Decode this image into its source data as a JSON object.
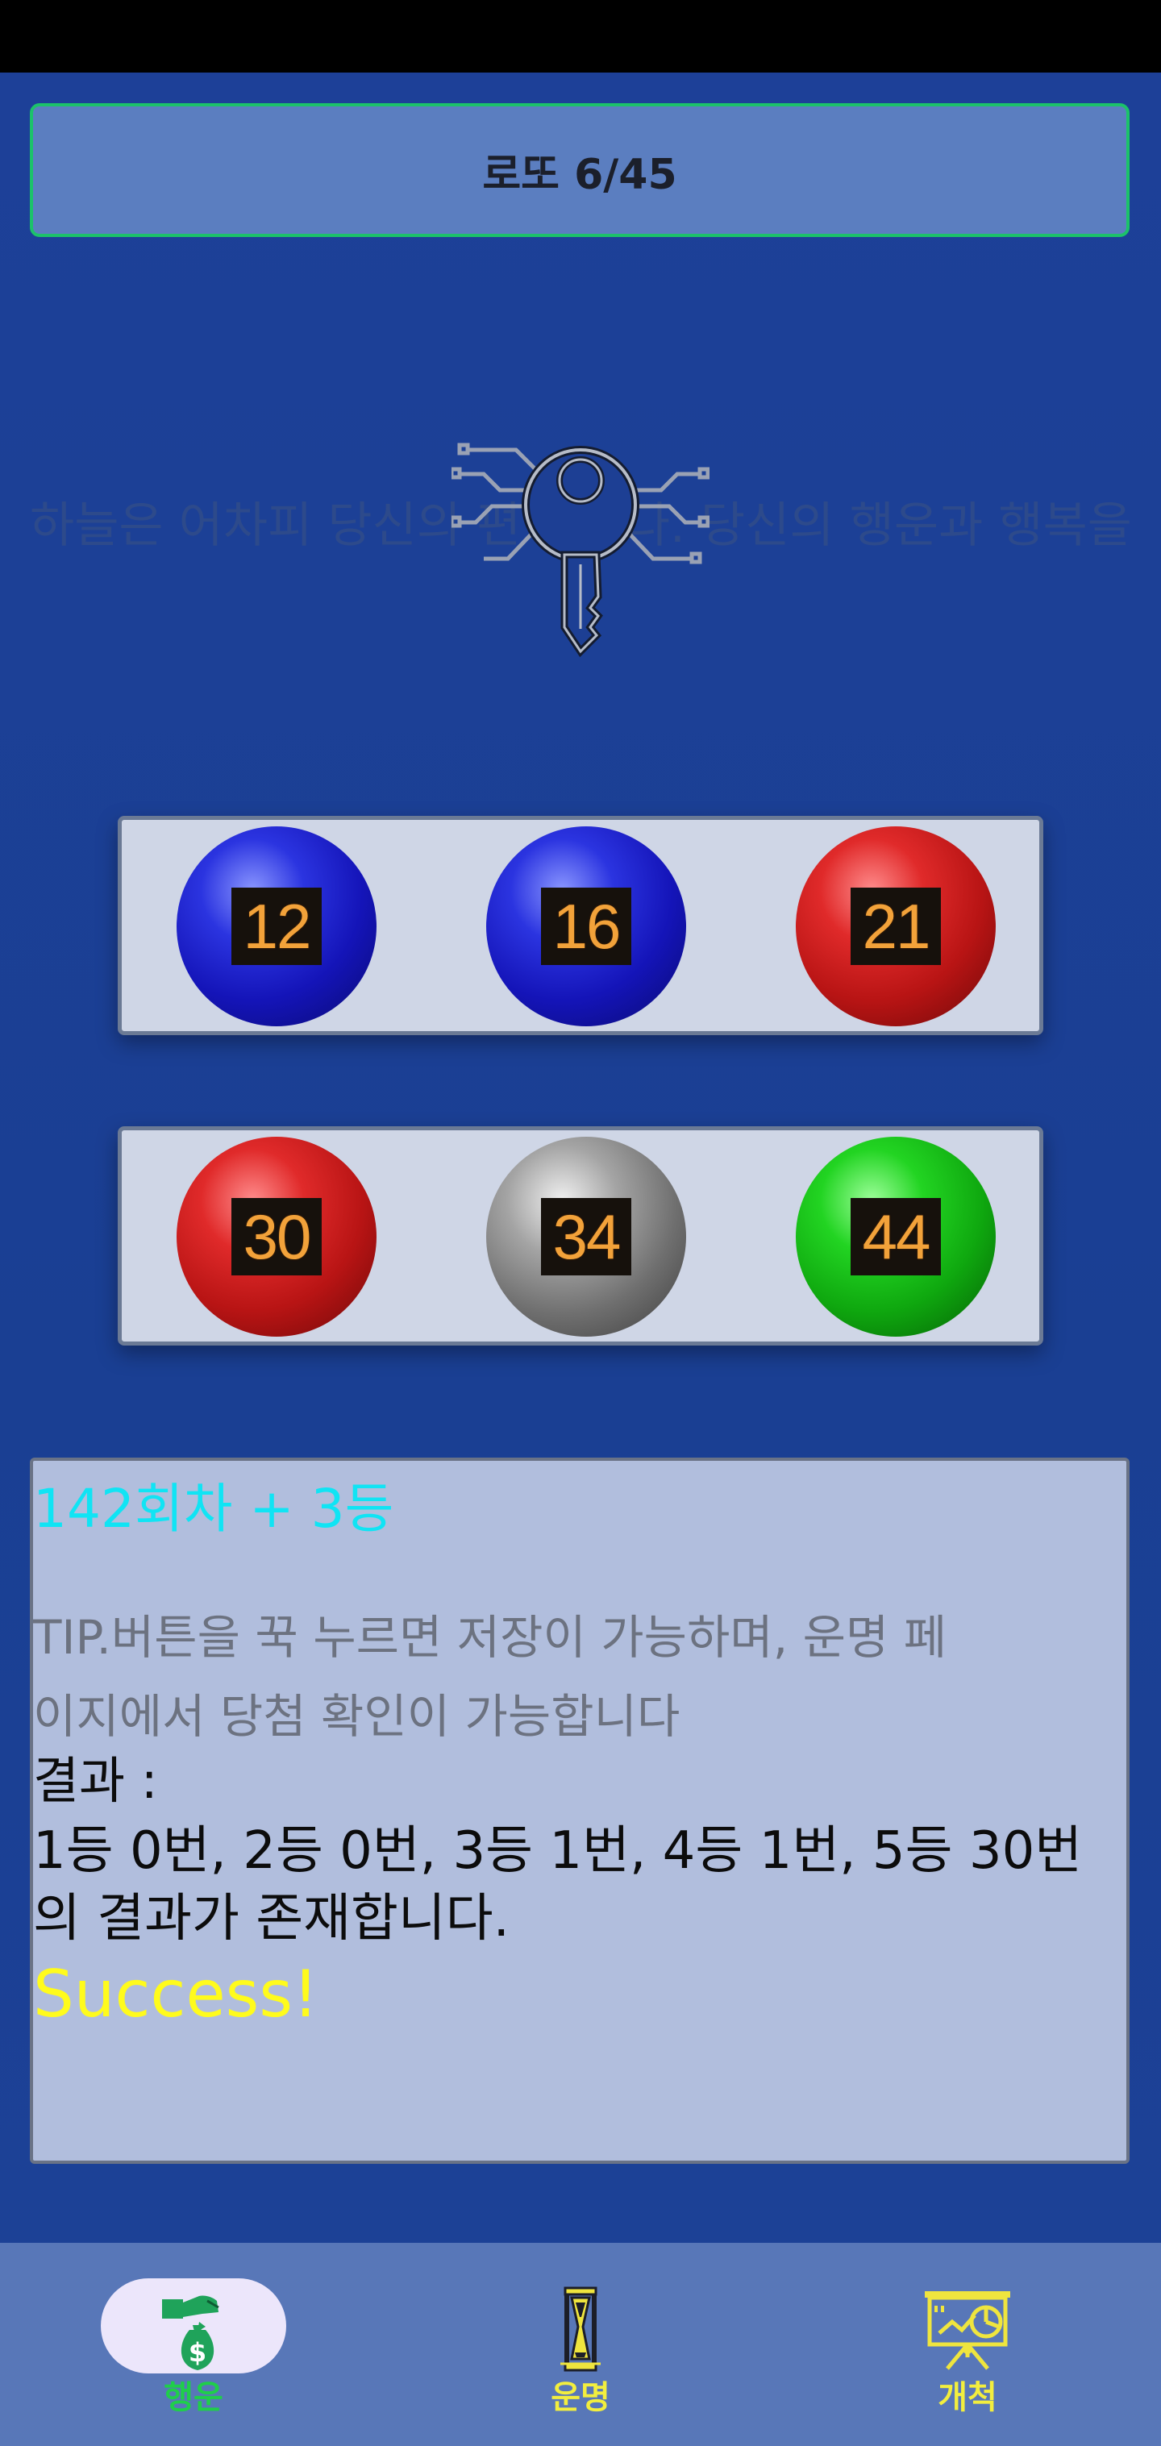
{
  "app": {
    "title": "로또 6/45"
  },
  "marquee_text": "하늘은 어차피 당신의 편 입니다. 당신의 행운과 행복을 빕니다.",
  "balls": [
    {
      "number": "12",
      "color": "blue"
    },
    {
      "number": "16",
      "color": "blue"
    },
    {
      "number": "21",
      "color": "red"
    },
    {
      "number": "30",
      "color": "red"
    },
    {
      "number": "34",
      "color": "gray"
    },
    {
      "number": "44",
      "color": "green"
    }
  ],
  "info": {
    "round": "142회차 + 3등",
    "tip": "TIP.버튼을 꾹 누르면 저장이 가능하며, 운명 페이지에서 당첨 확인이 가능합니다",
    "result_label": "결과 :",
    "result_text": "1등 0번, 2등 0번, 3등 1번, 4등 1번, 5등 30번의 결과가 존재합니다.",
    "success": "Success!"
  },
  "nav": {
    "items": [
      {
        "label": "행운",
        "icon": "money-bag-icon",
        "selected": true
      },
      {
        "label": "운명",
        "icon": "hourglass-icon",
        "selected": false
      },
      {
        "label": "개척",
        "icon": "presentation-chart-icon",
        "selected": false
      }
    ],
    "selected_color": "#1fce4a",
    "label_color": "#f2ee3e"
  },
  "colors": {
    "background": "#1a3f93",
    "title_border": "#1cc26a",
    "round_text": "#10e4f4",
    "success_text": "#fffb1c"
  }
}
